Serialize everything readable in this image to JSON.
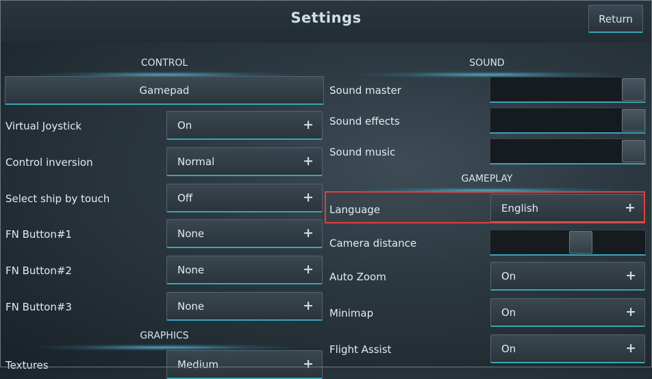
{
  "header": {
    "title": "Settings",
    "return_label": "Return"
  },
  "control": {
    "heading": "CONTROL",
    "gamepad_label": "Gamepad",
    "rows": [
      {
        "label": "Virtual Joystick",
        "value": "On"
      },
      {
        "label": "Control inversion",
        "value": "Normal"
      },
      {
        "label": "Select ship by touch",
        "value": "Off"
      },
      {
        "label": "FN Button#1",
        "value": "None"
      },
      {
        "label": "FN Button#2",
        "value": "None"
      },
      {
        "label": "FN Button#3",
        "value": "None"
      }
    ]
  },
  "graphics": {
    "heading": "GRAPHICS",
    "rows": [
      {
        "label": "Textures",
        "value": "Medium"
      }
    ]
  },
  "sound": {
    "heading": "SOUND",
    "rows": [
      {
        "label": "Sound master",
        "level": 1.0
      },
      {
        "label": "Sound effects",
        "level": 1.0
      },
      {
        "label": "Sound music",
        "level": 1.0
      }
    ]
  },
  "gameplay": {
    "heading": "GAMEPLAY",
    "language": {
      "label": "Language",
      "value": "English"
    },
    "camera": {
      "label": "Camera distance",
      "level": 0.6
    },
    "rows": [
      {
        "label": "Auto Zoom",
        "value": "On"
      },
      {
        "label": "Minimap",
        "value": "On"
      },
      {
        "label": "Flight Assist",
        "value": "On"
      }
    ]
  },
  "plus_glyph": "+",
  "colors": {
    "accent": "#3aa6b8",
    "highlight": "#e0403e"
  }
}
